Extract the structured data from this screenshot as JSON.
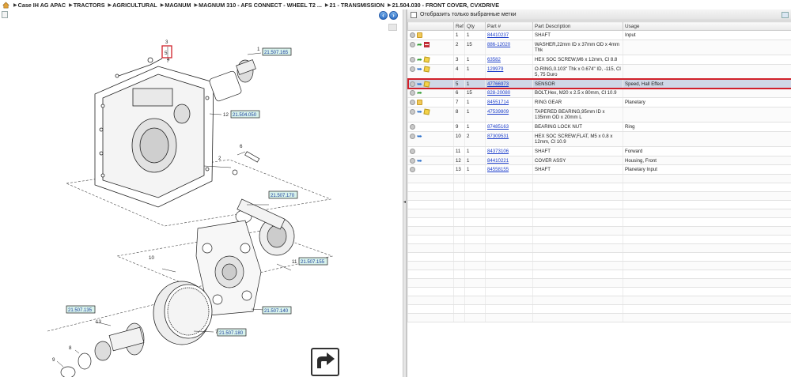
{
  "breadcrumb": {
    "items": [
      "Case IH AG APAC",
      "TRACTORS",
      "AGRICULTURAL",
      "MAGNUM",
      "MAGNUM 310 - AFS CONNECT - WHEEL T2 ...",
      "21 - TRANSMISSION",
      "21.504.030 - FRONT COVER, CVXDRIVE"
    ]
  },
  "filter": {
    "label": "Отобразить только выбранные метки"
  },
  "table": {
    "headers": [
      "Ref",
      "Qty",
      "Part #",
      "Part Description",
      "Usage"
    ],
    "rows": [
      {
        "ref": "1",
        "qty": "1",
        "part": "84410237",
        "desc": "SHAFT",
        "usage": "Input",
        "icons": [
          "folder"
        ]
      },
      {
        "ref": "2",
        "qty": "15",
        "part": "886-12020",
        "desc": "WASHER,22mm ID x 37mm OD x 4mm Thk",
        "usage": "",
        "icons": [
          "arrow-green",
          "bars"
        ]
      },
      {
        "ref": "3",
        "qty": "1",
        "part": "63582",
        "desc": "HEX SOC SCREW,M6 x 12mm, Cl 8.8",
        "usage": "",
        "icons": [
          "arrow-green",
          "box"
        ]
      },
      {
        "ref": "4",
        "qty": "1",
        "part": "129979",
        "desc": "O-RING,0.103\" Thk x 0.674\" ID, -115, Cl 5, 75 Duro",
        "usage": "",
        "icons": [
          "arrow-blue",
          "box"
        ]
      },
      {
        "ref": "5",
        "qty": "1",
        "part": "47766973",
        "desc": "SENSOR",
        "usage": "Speed, Hall Effect",
        "icons": [
          "arrow-blue",
          "box"
        ],
        "selected": true
      },
      {
        "ref": "6",
        "qty": "15",
        "part": "828-20080",
        "desc": "BOLT,Hex, M20 x 2.5 x 80mm, Cl 10.9",
        "usage": "",
        "icons": [
          "arrow-green"
        ]
      },
      {
        "ref": "7",
        "qty": "1",
        "part": "84551714",
        "desc": "RING GEAR",
        "usage": "Planetary",
        "icons": [
          "folder"
        ]
      },
      {
        "ref": "8",
        "qty": "1",
        "part": "47539809",
        "desc": "TAPERED BEARING,95mm ID x 135mm OD x 20mm L",
        "usage": "",
        "icons": [
          "arrow-blue",
          "box"
        ]
      },
      {
        "ref": "9",
        "qty": "1",
        "part": "87485163",
        "desc": "BEARING LOCK NUT",
        "usage": "Ring",
        "icons": []
      },
      {
        "ref": "10",
        "qty": "2",
        "part": "87309531",
        "desc": "HEX SOC SCREW,FLAT, M5 x 0.8 x 12mm, Cl 10.9",
        "usage": "",
        "icons": [
          "arrow-blue"
        ]
      },
      {
        "ref": "11",
        "qty": "1",
        "part": "84373106",
        "desc": "SHAFT",
        "usage": "Forward",
        "icons": []
      },
      {
        "ref": "12",
        "qty": "1",
        "part": "84410221",
        "desc": "COVER ASSY",
        "usage": "Housing, Front",
        "icons": [
          "arrow-blue"
        ]
      },
      {
        "ref": "13",
        "qty": "1",
        "part": "84558155",
        "desc": "SHAFT",
        "usage": "Planetary Input",
        "icons": []
      }
    ]
  },
  "diagram": {
    "callouts": {
      "c1": "1",
      "c2": "2",
      "c3": "3",
      "c4": "4",
      "c5": "5",
      "c6": "6",
      "c7": "7",
      "c8": "8",
      "c9": "9",
      "c10": "10",
      "c11": "11",
      "c12": "12",
      "c13": "13"
    },
    "refs": {
      "r1": "21.507.165",
      "r12": "21.504.050",
      "r_mid": "21.507.170",
      "r11": "21.507.155",
      "r_left": "21.507.135",
      "r_right": "21.507.140",
      "r7": "21.507.180"
    }
  },
  "colors": {
    "selected_row": "#cfd8e6",
    "highlight_outline": "#d0202a",
    "link": "#1a3cc9",
    "ref_fill": "#d9f3ec"
  }
}
